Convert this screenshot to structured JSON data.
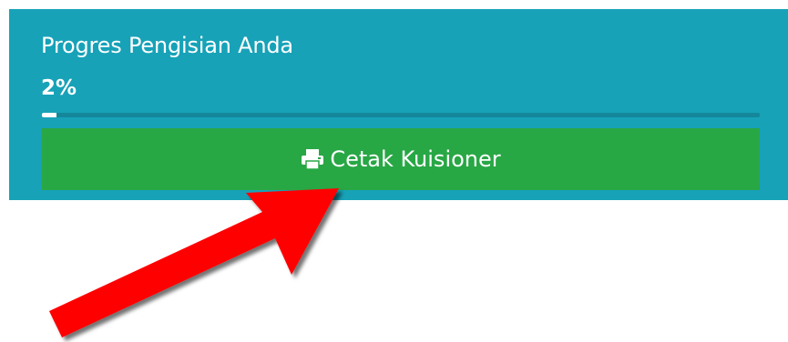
{
  "progress": {
    "title": "Progres Pengisian Anda",
    "percent_label": "2%",
    "percent_value": 2
  },
  "actions": {
    "print_label": "Cetak Kuisioner",
    "print_icon": "print-icon"
  },
  "colors": {
    "panel": "#17a2b8",
    "button": "#28a745",
    "arrow": "#ff0000"
  }
}
